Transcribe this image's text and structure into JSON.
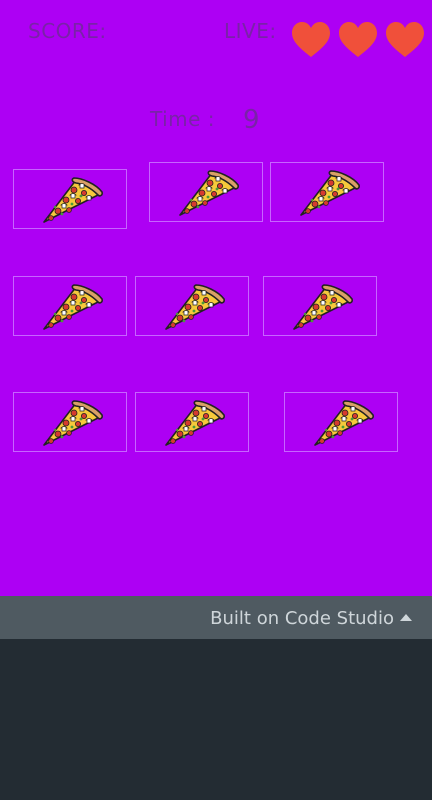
{
  "hud": {
    "score_label": "SCORE:",
    "lives_label": "LIVE:",
    "lives": 3,
    "time_label": "Time :",
    "time_value": "9"
  },
  "tiles": [
    {
      "icon": "pizza-slice-icon"
    },
    {
      "icon": "pizza-slice-icon"
    },
    {
      "icon": "pizza-slice-icon"
    },
    {
      "icon": "pizza-slice-icon"
    },
    {
      "icon": "pizza-slice-icon"
    },
    {
      "icon": "pizza-slice-icon"
    },
    {
      "icon": "pizza-slice-icon"
    },
    {
      "icon": "pizza-slice-icon"
    },
    {
      "icon": "pizza-slice-icon"
    }
  ],
  "footer": {
    "built_label": "Built on Code Studio"
  },
  "colors": {
    "game_background": "#ad00f4",
    "hud_text": "#7a22a8",
    "heart": "#f0503a",
    "footer_bar": "#4f5a61",
    "page_background": "#232c33"
  }
}
